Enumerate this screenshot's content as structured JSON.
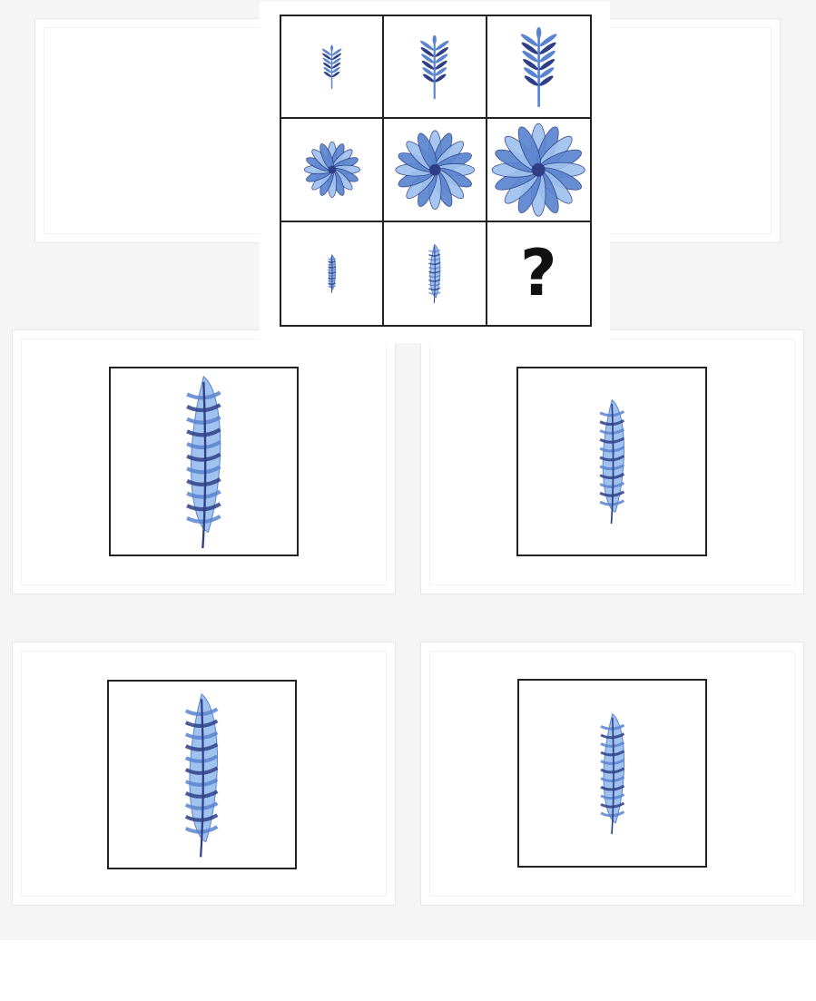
{
  "puzzle": {
    "rows": [
      {
        "shape": "sprig-icon",
        "scales": [
          0.55,
          0.8,
          1.0
        ]
      },
      {
        "shape": "flower-icon",
        "scales": [
          0.6,
          0.85,
          1.0
        ]
      },
      {
        "shape": "feather-icon",
        "scales": [
          0.55,
          0.85
        ]
      }
    ],
    "missing_label": "?"
  },
  "options": [
    {
      "shape": "feather-icon",
      "length": 1.0
    },
    {
      "shape": "feather-icon",
      "length": 0.72
    },
    {
      "shape": "feather-icon",
      "length": 0.95
    },
    {
      "shape": "feather-icon",
      "length": 0.7
    }
  ],
  "colors": {
    "blue_light": "#9fc2ef",
    "blue_mid": "#5b84cf",
    "blue_dark": "#2e3f86",
    "border": "#222222"
  }
}
